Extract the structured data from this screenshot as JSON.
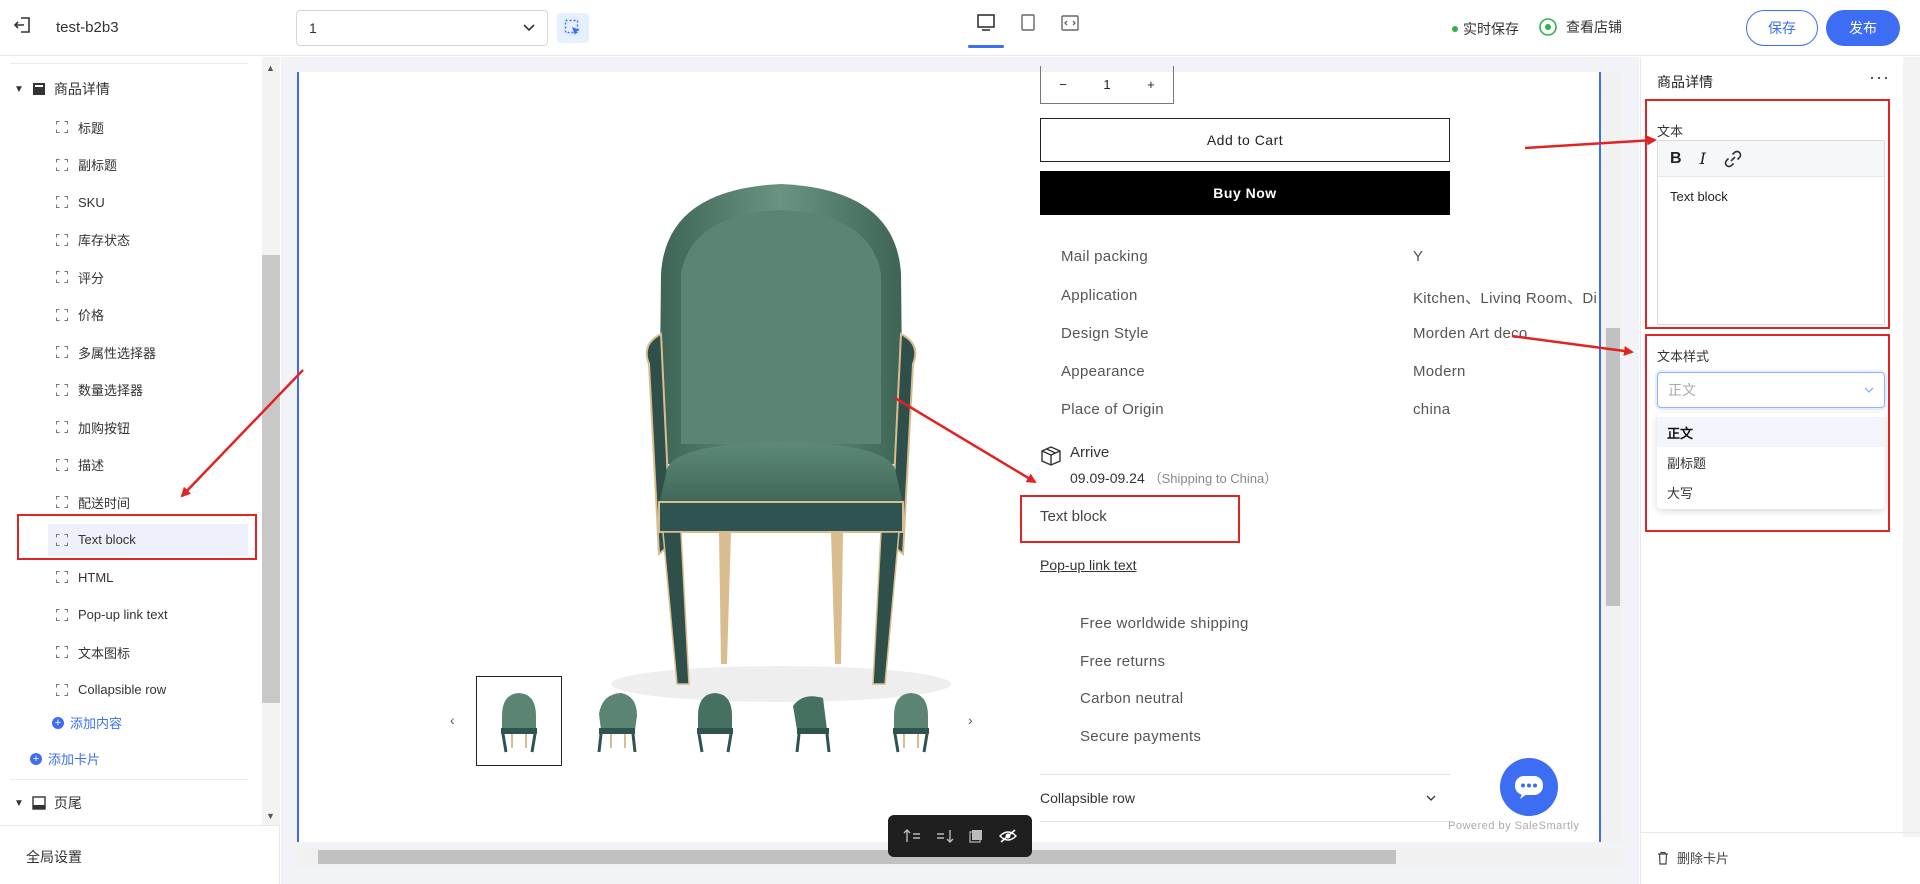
{
  "topbar": {
    "store_name": "test-b2b3",
    "page_select_value": "1",
    "realtime_save": "实时保存",
    "view_store": "查看店铺",
    "save_label": "保存",
    "publish_label": "发布"
  },
  "sidebar": {
    "group_product": "商品详情",
    "items": [
      "标题",
      "副标题",
      "SKU",
      "库存状态",
      "评分",
      "价格",
      "多属性选择器",
      "数量选择器",
      "加购按钮",
      "描述",
      "配送时间",
      "Text block",
      "HTML",
      "Pop-up link text",
      "文本图标",
      "Collapsible row"
    ],
    "selected_item": "Text block",
    "add_content": "添加内容",
    "add_card": "添加卡片",
    "group_footer": "页尾",
    "global_settings": "全局设置"
  },
  "product": {
    "quantity": "1",
    "add_to_cart": "Add to Cart",
    "buy_now": "Buy Now",
    "specs": [
      {
        "k": "Mail packing",
        "v": "Y"
      },
      {
        "k": "Application",
        "v": "Kitchen、Living Room、Di"
      },
      {
        "k": "Design Style",
        "v": "Morden Art deco"
      },
      {
        "k": "Appearance",
        "v": "Modern"
      },
      {
        "k": "Place of Origin",
        "v": "china"
      }
    ],
    "arrive_title": "Arrive",
    "arrive_date": "09.09-09.24",
    "arrive_note": "（Shipping to China）",
    "text_block": "Text block",
    "popup_link": "Pop-up link text",
    "perks": [
      "Free worldwide shipping",
      "Free returns",
      "Carbon neutral",
      "Secure payments"
    ],
    "collapsible_row": "Collapsible row",
    "powered_by": "Powered by SaleSmartly"
  },
  "right_panel": {
    "title": "商品详情",
    "text_label": "文本",
    "editor_content": "Text block",
    "style_label": "文本样式",
    "style_placeholder": "正文",
    "style_options": [
      "正文",
      "副标题",
      "大写"
    ],
    "delete_card": "删除卡片"
  },
  "colors": {
    "accent": "#3d6df2",
    "annotation_red": "#e02424",
    "chair_green": "#4f7a68",
    "chair_leg": "#d9bd8f"
  }
}
